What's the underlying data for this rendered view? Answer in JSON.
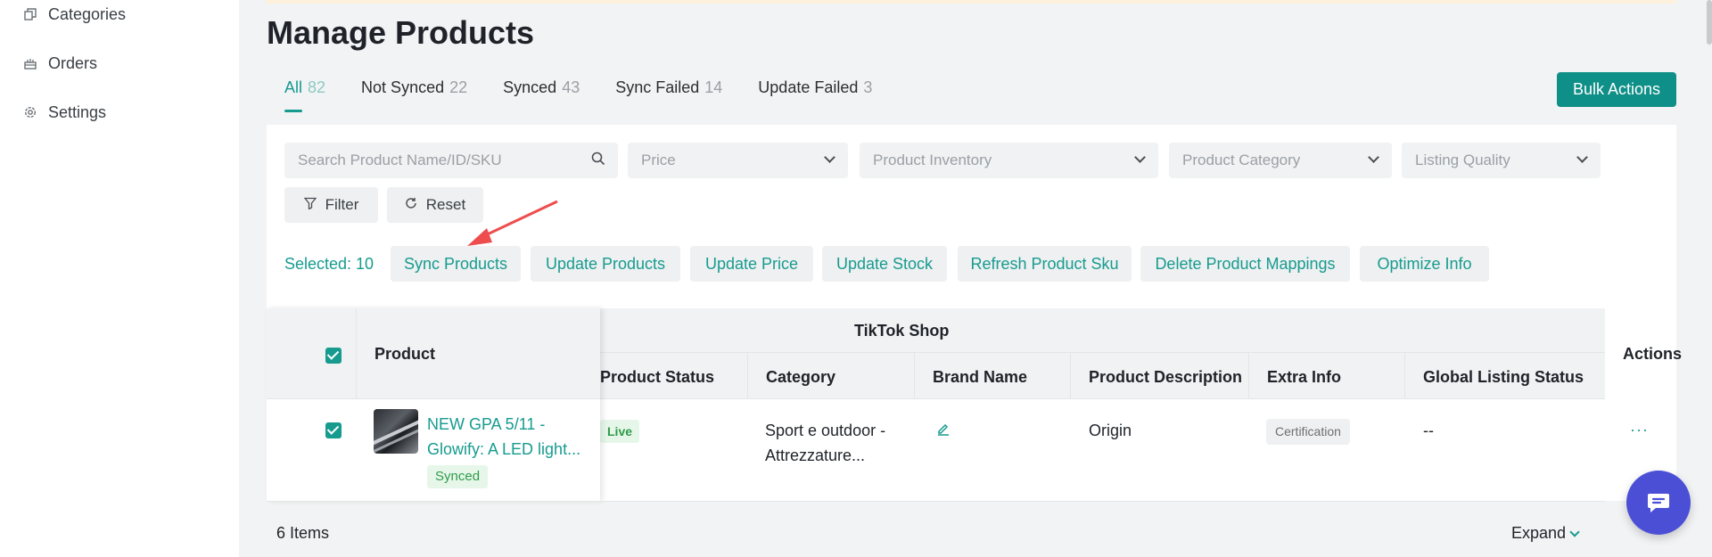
{
  "sidebar": {
    "items": [
      {
        "label": "Categories",
        "icon": "copy-icon"
      },
      {
        "label": "Orders",
        "icon": "cake-icon"
      },
      {
        "label": "Settings",
        "icon": "gear-icon"
      }
    ]
  },
  "page": {
    "title": "Manage Products"
  },
  "tabs": [
    {
      "label": "All",
      "count": "82",
      "active": true
    },
    {
      "label": "Not Synced",
      "count": "22"
    },
    {
      "label": "Synced",
      "count": "43"
    },
    {
      "label": "Sync Failed",
      "count": "14"
    },
    {
      "label": "Update Failed",
      "count": "3"
    }
  ],
  "bulk_actions_label": "Bulk Actions",
  "filters": {
    "search_placeholder": "Search Product Name/ID/SKU",
    "price": "Price",
    "inventory": "Product Inventory",
    "category": "Product Category",
    "listing_quality": "Listing Quality",
    "filter_label": "Filter",
    "reset_label": "Reset"
  },
  "selection": {
    "text": "Selected: 10",
    "actions": [
      "Sync Products",
      "Update Products",
      "Update Price",
      "Update Stock",
      "Refresh Product Sku",
      "Delete Product Mappings",
      "Optimize Info"
    ]
  },
  "table": {
    "group_header": "TikTok Shop",
    "columns": {
      "product": "Product",
      "status": "Product Status",
      "category": "Category",
      "brand": "Brand Name",
      "description": "Product Description",
      "extra": "Extra Info",
      "global_status": "Global Listing Status",
      "actions": "Actions"
    },
    "rows": [
      {
        "product_name_line1": "NEW GPA 5/11 -",
        "product_name_line2": "Glowify: A LED light...",
        "sync_badge": "Synced",
        "status": "Live",
        "category_line1": "Sport e outdoor -",
        "category_line2": "Attrezzature...",
        "description": "Origin",
        "extra": "Certification",
        "global_status": "--",
        "more": "···"
      }
    ],
    "footer_items": "6 Items",
    "expand_label": "Expand"
  },
  "colors": {
    "accent": "#179b8f",
    "primary_button": "#0e8f87",
    "chat": "#4b4fd6",
    "annotation_arrow": "#ef4d4d"
  }
}
